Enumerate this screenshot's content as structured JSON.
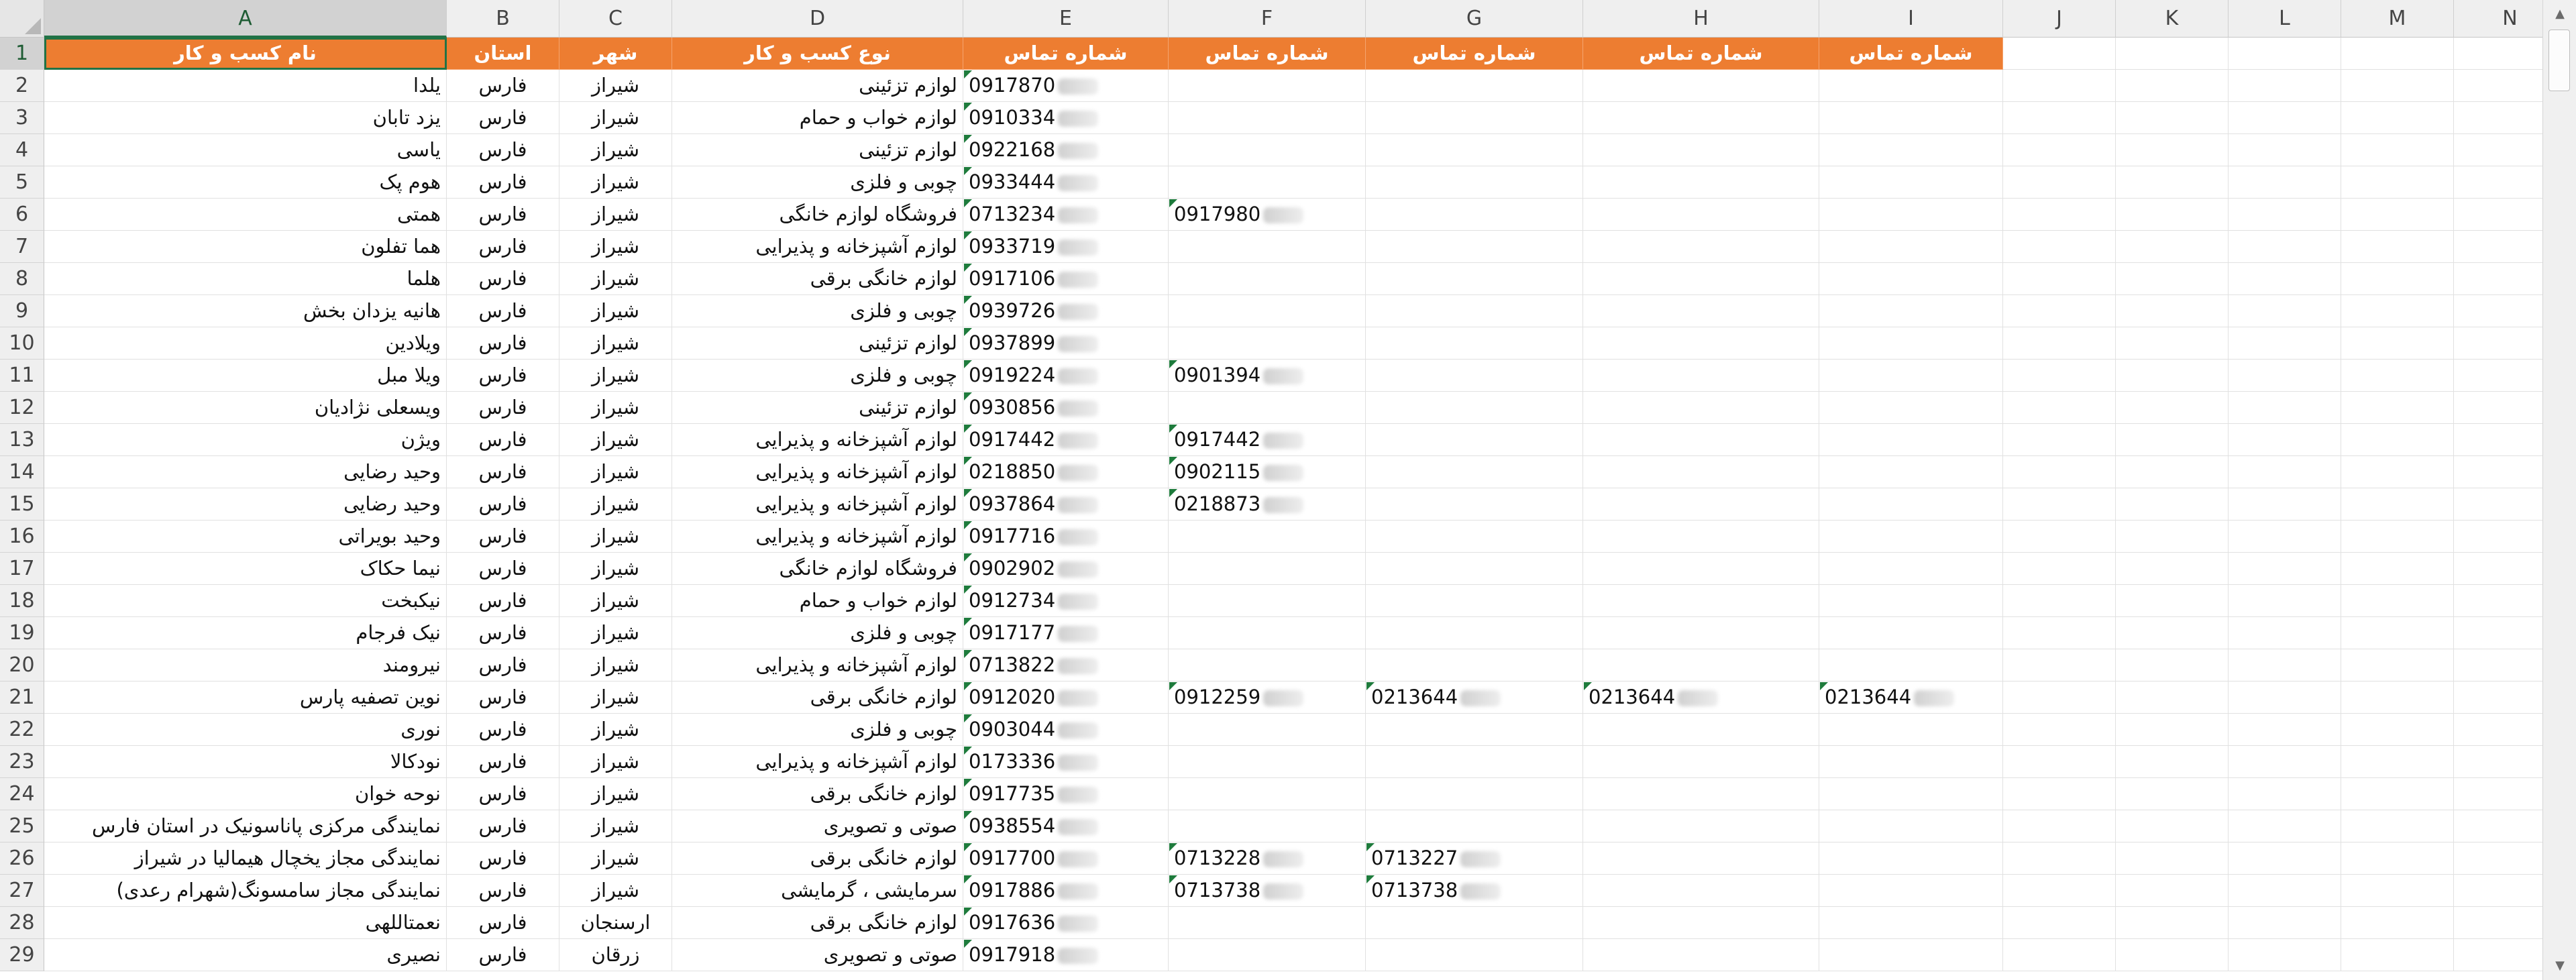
{
  "columns": [
    "A",
    "B",
    "C",
    "D",
    "E",
    "F",
    "G",
    "H",
    "I",
    "J",
    "K",
    "L",
    "M",
    "N"
  ],
  "header_row": {
    "A": "نام کسب و کار",
    "B": "استان",
    "C": "شهر",
    "D": "نوع کسب و کار",
    "E": "شماره تماس",
    "F": "شماره تماس",
    "G": "شماره تماس",
    "H": "شماره تماس",
    "I": "شماره تماس"
  },
  "rows": [
    {
      "n": "2",
      "a": "یلدا",
      "b": "فارس",
      "c": "شیراز",
      "d": "لوازم تزئینی",
      "e": "0917870"
    },
    {
      "n": "3",
      "a": "یزد تابان",
      "b": "فارس",
      "c": "شیراز",
      "d": "لوازم خواب و حمام",
      "e": "0910334"
    },
    {
      "n": "4",
      "a": "یاسی",
      "b": "فارس",
      "c": "شیراز",
      "d": "لوازم تزئینی",
      "e": "0922168"
    },
    {
      "n": "5",
      "a": "هوم پک",
      "b": "فارس",
      "c": "شیراز",
      "d": "چوبی و فلزی",
      "e": "0933444"
    },
    {
      "n": "6",
      "a": "همتی",
      "b": "فارس",
      "c": "شیراز",
      "d": "فروشگاه لوازم خانگی",
      "e": "0713234",
      "f": "0917980"
    },
    {
      "n": "7",
      "a": "هما تفلون",
      "b": "فارس",
      "c": "شیراز",
      "d": "لوازم آشپزخانه و پذیرایی",
      "e": "0933719"
    },
    {
      "n": "8",
      "a": "هلما",
      "b": "فارس",
      "c": "شیراز",
      "d": "لوازم خانگی برقی",
      "e": "0917106"
    },
    {
      "n": "9",
      "a": "هانیه یزدان بخش",
      "b": "فارس",
      "c": "شیراز",
      "d": "چوبی و فلزی",
      "e": "0939726"
    },
    {
      "n": "10",
      "a": "ویلادین",
      "b": "فارس",
      "c": "شیراز",
      "d": "لوازم تزئینی",
      "e": "0937899"
    },
    {
      "n": "11",
      "a": "ویلا مبل",
      "b": "فارس",
      "c": "شیراز",
      "d": "چوبی و فلزی",
      "e": "0919224",
      "f": "0901394"
    },
    {
      "n": "12",
      "a": "ویسعلی نژادیان",
      "b": "فارس",
      "c": "شیراز",
      "d": "لوازم تزئینی",
      "e": "0930856"
    },
    {
      "n": "13",
      "a": "ویژن",
      "b": "فارس",
      "c": "شیراز",
      "d": "لوازم آشپزخانه و پذیرایی",
      "e": "0917442",
      "f": "0917442"
    },
    {
      "n": "14",
      "a": "وحید رضایی",
      "b": "فارس",
      "c": "شیراز",
      "d": "لوازم آشپزخانه و پذیرایی",
      "e": "0218850",
      "f": "0902115"
    },
    {
      "n": "15",
      "a": "وحید رضایی",
      "b": "فارس",
      "c": "شیراز",
      "d": "لوازم آشپزخانه و پذیرایی",
      "e": "0937864",
      "f": "0218873"
    },
    {
      "n": "16",
      "a": "وحید بویراتی",
      "b": "فارس",
      "c": "شیراز",
      "d": "لوازم آشپزخانه و پذیرایی",
      "e": "0917716"
    },
    {
      "n": "17",
      "a": "نیما حکاک",
      "b": "فارس",
      "c": "شیراز",
      "d": "فروشگاه لوازم خانگی",
      "e": "0902902"
    },
    {
      "n": "18",
      "a": "نیکبخت",
      "b": "فارس",
      "c": "شیراز",
      "d": "لوازم خواب و حمام",
      "e": "0912734"
    },
    {
      "n": "19",
      "a": "نیک فرجام",
      "b": "فارس",
      "c": "شیراز",
      "d": "چوبی و فلزی",
      "e": "0917177"
    },
    {
      "n": "20",
      "a": "نیرومند",
      "b": "فارس",
      "c": "شیراز",
      "d": "لوازم آشپزخانه و پذیرایی",
      "e": "0713822"
    },
    {
      "n": "21",
      "a": "نوین تصفیه پارس",
      "b": "فارس",
      "c": "شیراز",
      "d": "لوازم خانگی برقی",
      "e": "0912020",
      "f": "0912259",
      "g": "0213644",
      "h": "0213644",
      "i": "0213644"
    },
    {
      "n": "22",
      "a": "نوری",
      "b": "فارس",
      "c": "شیراز",
      "d": "چوبی و فلزی",
      "e": "0903044"
    },
    {
      "n": "23",
      "a": "نودکالا",
      "b": "فارس",
      "c": "شیراز",
      "d": "لوازم آشپزخانه و پذیرایی",
      "e": "0173336"
    },
    {
      "n": "24",
      "a": "نوحه خوان",
      "b": "فارس",
      "c": "شیراز",
      "d": "لوازم خانگی برقی",
      "e": "0917735"
    },
    {
      "n": "25",
      "a": "نمایندگی مرکزی  پاناسونیک در استان فارس",
      "b": "فارس",
      "c": "شیراز",
      "d": "صوتی و تصویری",
      "e": "0938554"
    },
    {
      "n": "26",
      "a": "نمایندگی مجاز یخچال  هیمالیا در شیراز",
      "b": "فارس",
      "c": "شیراز",
      "d": "لوازم خانگی برقی",
      "e": "0917700",
      "f": "0713228",
      "g": "0713227"
    },
    {
      "n": "27",
      "a": "نمایندگی مجاز سامسونگ(شهرام رعدی)",
      "b": "فارس",
      "c": "شیراز",
      "d": "سرمایشی ، گرمایشی",
      "e": "0917886",
      "f": "0713738",
      "g": "0713738"
    },
    {
      "n": "28",
      "a": "نعمتاللهی",
      "b": "فارس",
      "c": "ارسنجان",
      "d": "لوازم خانگی برقی",
      "e": "0917636"
    },
    {
      "n": "29",
      "a": "نصیری",
      "b": "فارس",
      "c": "زرقان",
      "d": "صوتی و تصویری",
      "e": "0917918"
    }
  ],
  "scrollbar": {
    "up_glyph": "▲",
    "down_glyph": "▼"
  },
  "colors": {
    "header_fill": "#ed7d31",
    "header_text": "#ffffff",
    "selection": "#217346",
    "note_marker": "#1e7b3c"
  }
}
